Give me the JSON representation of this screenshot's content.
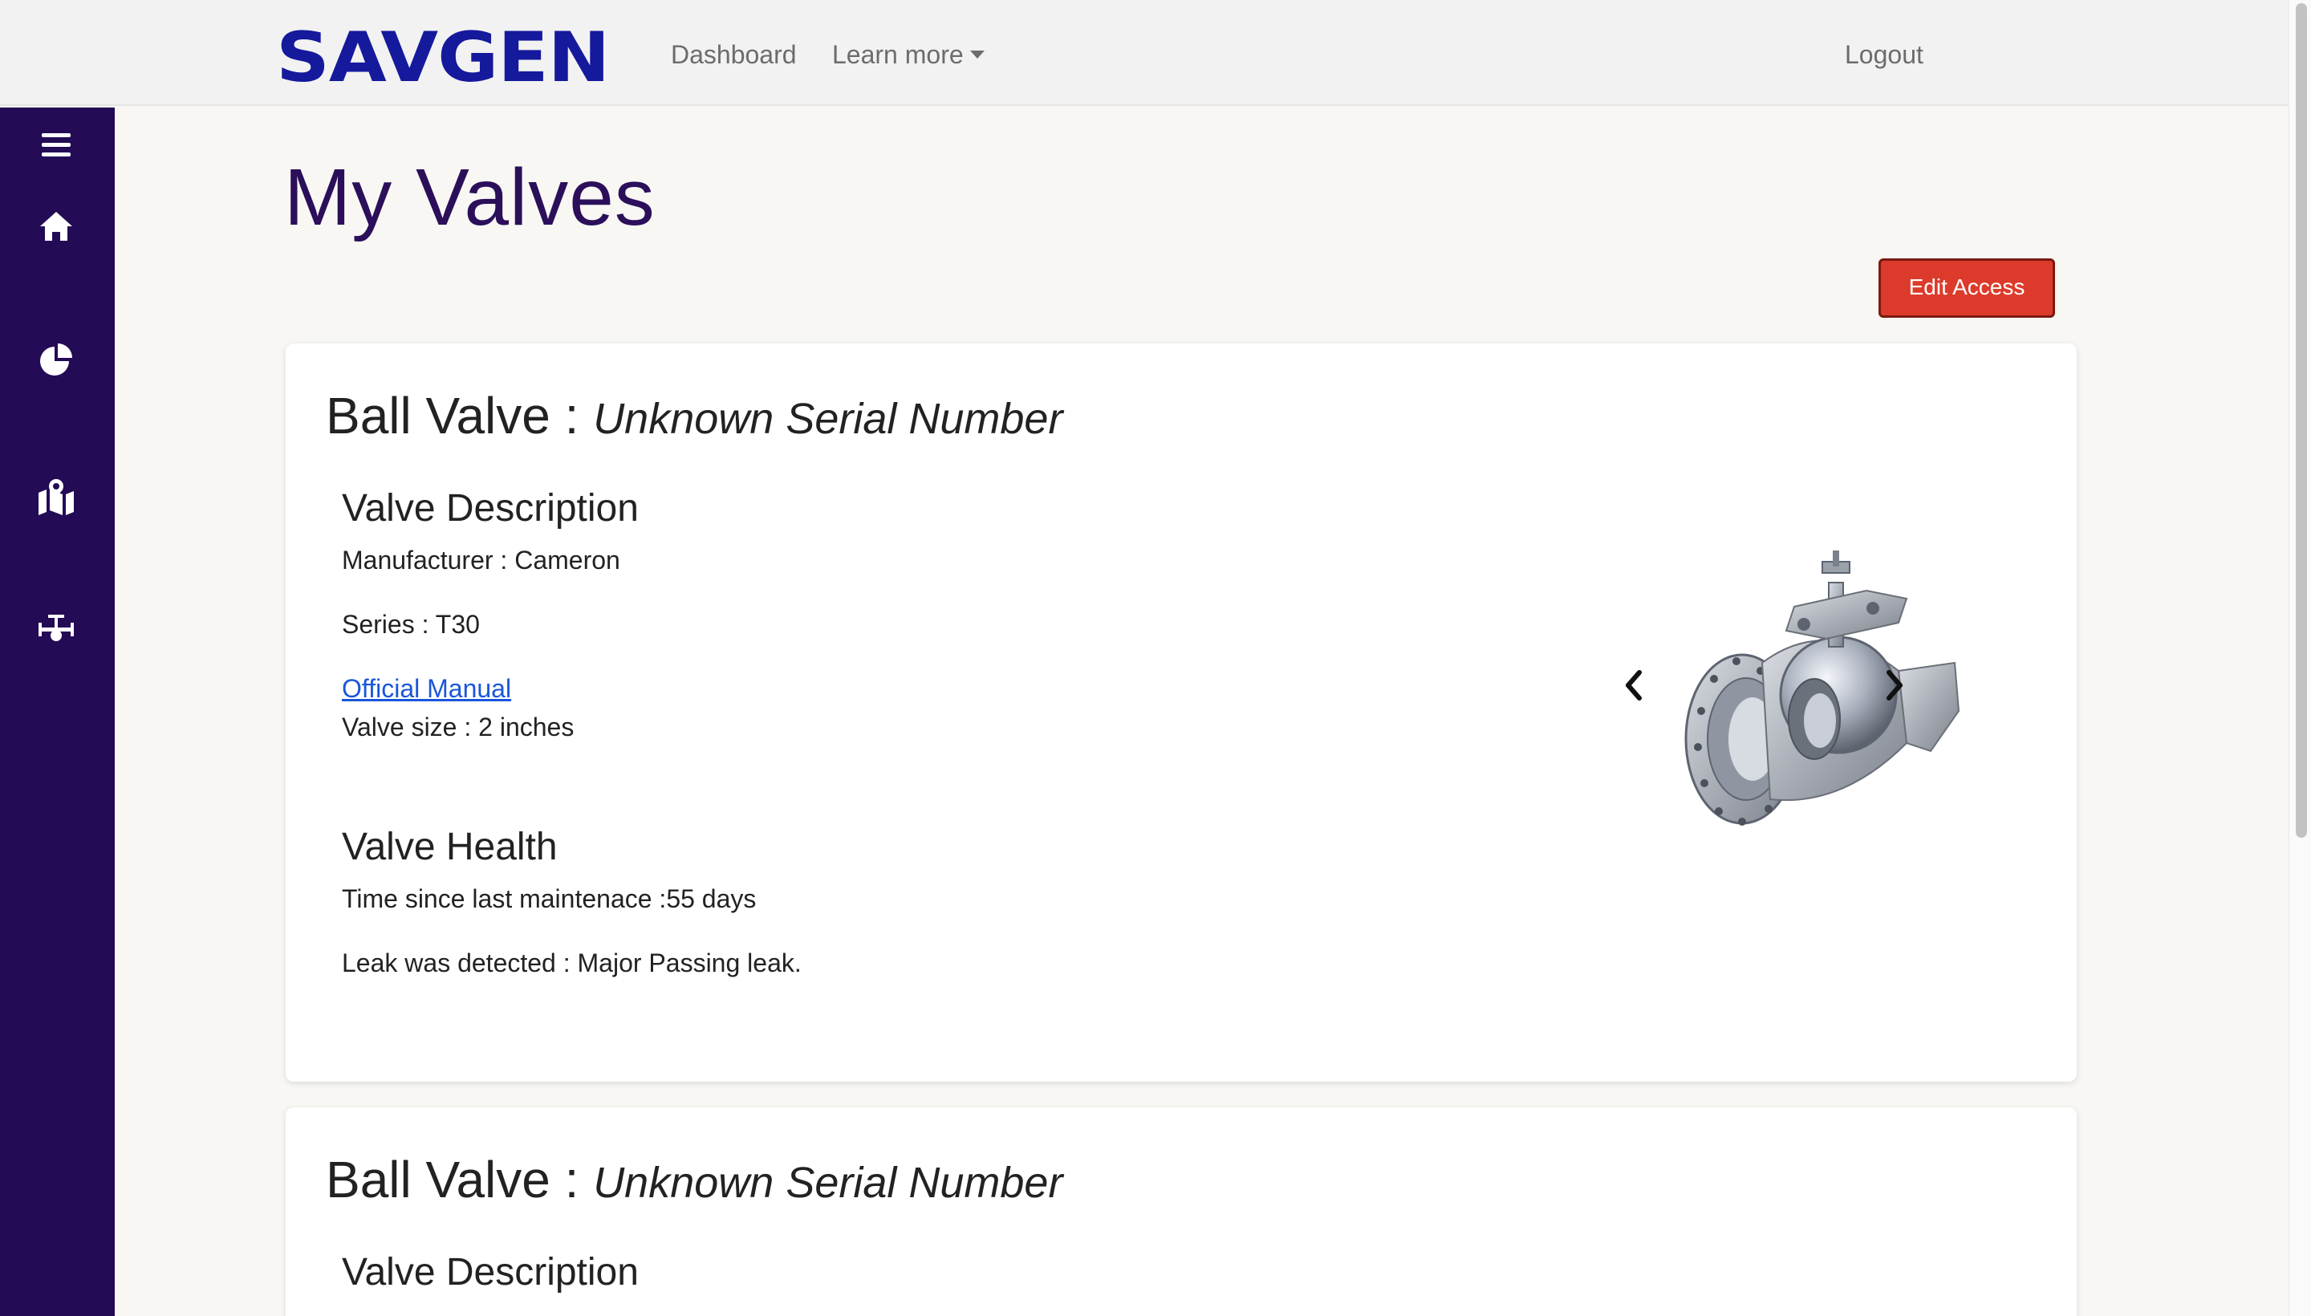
{
  "brand": {
    "logo_text": "SAVGEN",
    "logo_color": "#15199c"
  },
  "nav": {
    "dashboard": "Dashboard",
    "learn_more": "Learn more",
    "logout": "Logout"
  },
  "sidebar": {
    "color": "#230b56",
    "icons": [
      "menu-icon",
      "home-icon",
      "pie-chart-icon",
      "map-pin-icon",
      "valve-icon"
    ]
  },
  "page": {
    "title": "My Valves",
    "edit_access": "Edit Access"
  },
  "valves": [
    {
      "type": "Ball Valve",
      "separator": " : ",
      "serial": "Unknown Serial Number",
      "description_title": "Valve Description",
      "manufacturer": "Manufacturer : Cameron",
      "series": "Series : T30",
      "manual_link": "Official Manual",
      "size": "Valve size : 2 inches",
      "health_title": "Valve Health",
      "maintenance": "Time since last maintenace :55 days",
      "leak": "Leak was detected : Major Passing leak."
    },
    {
      "type": "Ball Valve",
      "separator": " : ",
      "serial": "Unknown Serial Number",
      "description_title": "Valve Description"
    }
  ],
  "colors": {
    "accent_red": "#dc3b2b",
    "title_purple": "#2b0f5a",
    "link_blue": "#1a56db"
  }
}
